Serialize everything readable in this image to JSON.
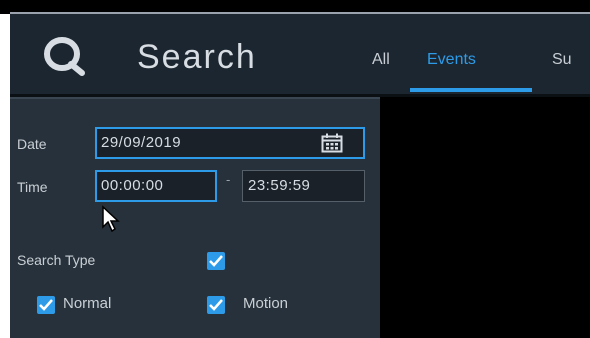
{
  "header": {
    "title": "Search",
    "tabs": [
      {
        "label": "All",
        "active": false
      },
      {
        "label": "Events",
        "active": true
      },
      {
        "label": "Su",
        "active": false
      }
    ]
  },
  "colors": {
    "accent": "#2e9be8",
    "header_bg": "#1c2630",
    "panel_bg": "#26313b"
  },
  "form": {
    "date": {
      "label": "Date",
      "value": "29/09/2019",
      "icon": "calendar-icon"
    },
    "time": {
      "label": "Time",
      "start": "00:00:00",
      "separator": "-",
      "end": "23:59:59"
    },
    "search_type": {
      "label": "Search Type",
      "checked": true
    },
    "types": [
      {
        "label": "Normal",
        "checked": true
      },
      {
        "label": "Motion",
        "checked": true
      }
    ]
  }
}
